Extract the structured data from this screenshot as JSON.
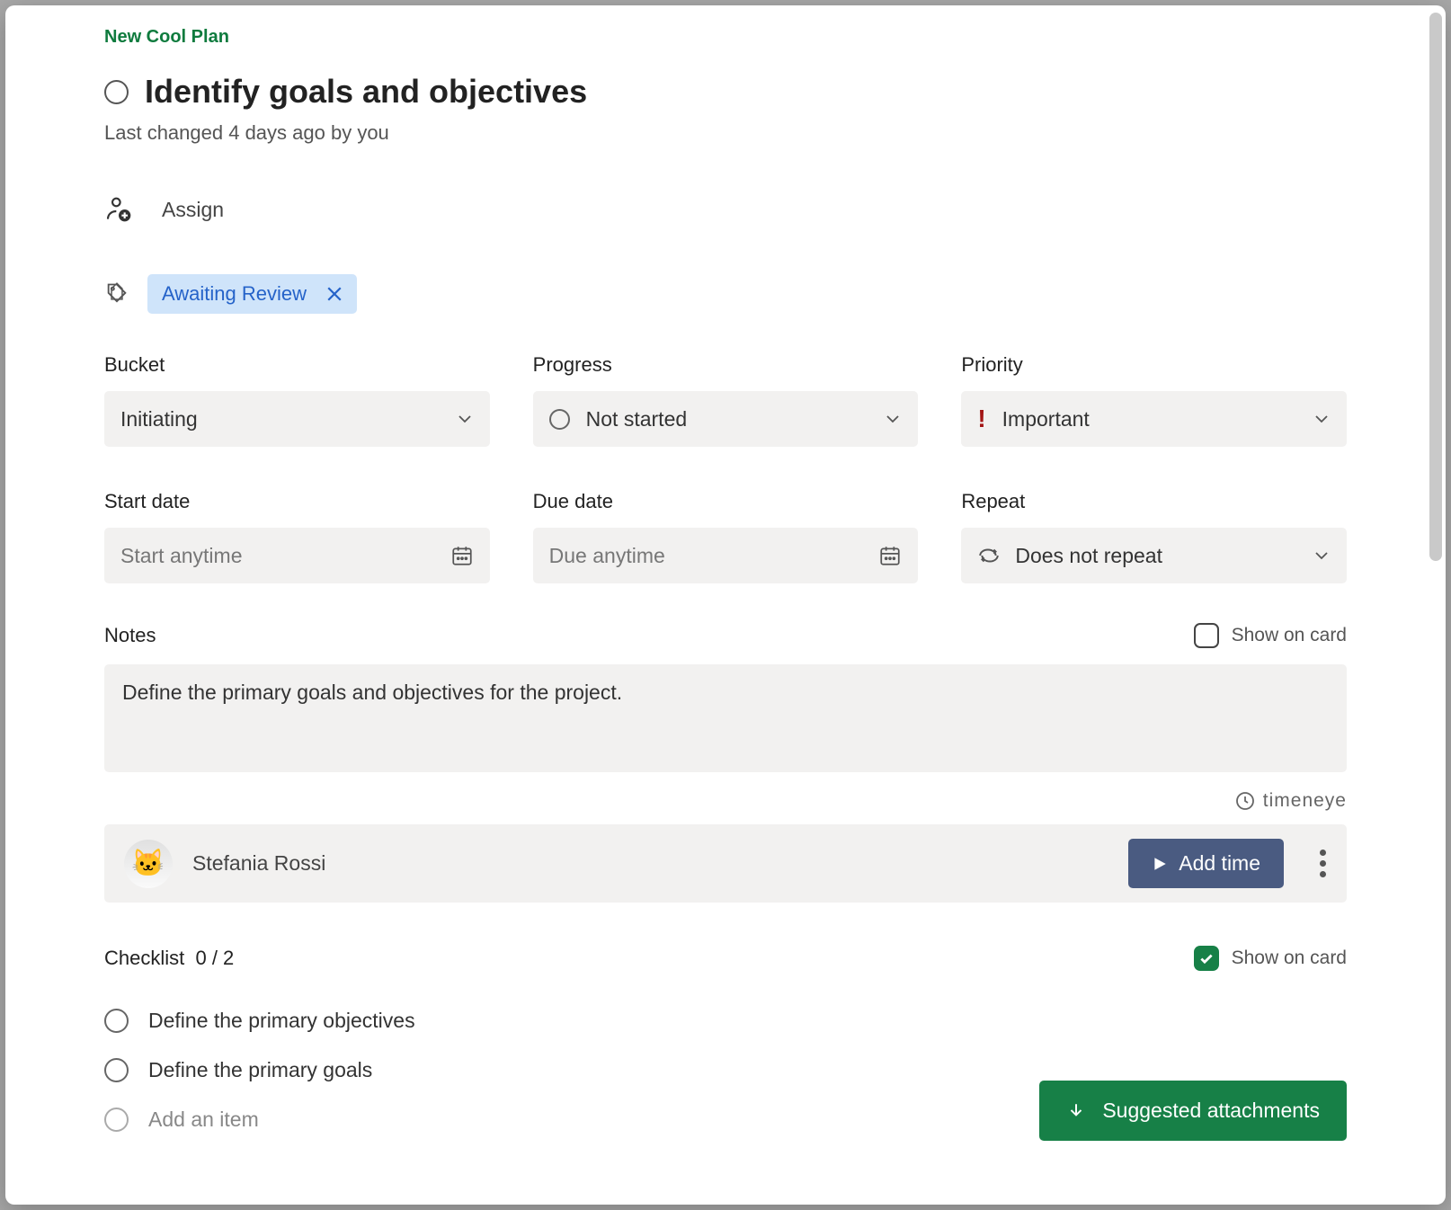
{
  "plan_name": "New Cool Plan",
  "task_title": "Identify goals and objectives",
  "last_changed": "Last changed 4 days ago by you",
  "assign_label": "Assign",
  "tag": {
    "label": "Awaiting Review"
  },
  "fields": {
    "bucket": {
      "label": "Bucket",
      "value": "Initiating"
    },
    "progress": {
      "label": "Progress",
      "value": "Not started"
    },
    "priority": {
      "label": "Priority",
      "value": "Important"
    },
    "start_date": {
      "label": "Start date",
      "placeholder": "Start anytime"
    },
    "due_date": {
      "label": "Due date",
      "placeholder": "Due anytime"
    },
    "repeat": {
      "label": "Repeat",
      "value": "Does not repeat"
    }
  },
  "notes": {
    "label": "Notes",
    "show_on_card_label": "Show on card",
    "show_on_card_checked": false,
    "text": "Define the primary goals and objectives for the project."
  },
  "timeneye": {
    "brand": "timeneye",
    "user": "Stefania Rossi",
    "add_time_label": "Add time"
  },
  "checklist": {
    "label": "Checklist",
    "count": "0 / 2",
    "show_on_card_label": "Show on card",
    "show_on_card_checked": true,
    "items": [
      "Define the primary objectives",
      "Define the primary goals"
    ],
    "add_placeholder": "Add an item"
  },
  "suggested_attachments_label": "Suggested attachments"
}
